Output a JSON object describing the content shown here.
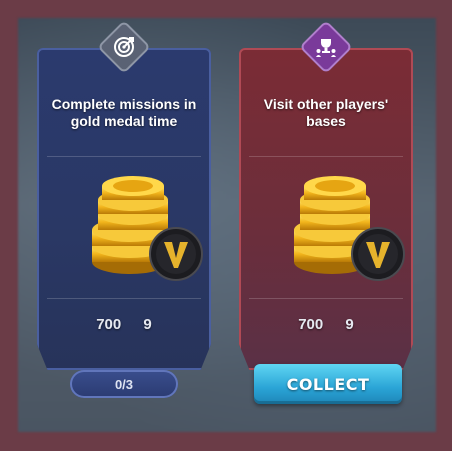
{
  "cards": [
    {
      "title": "Complete missions in gold medal time",
      "icon": "target-icon",
      "rewards": {
        "coins": "700",
        "v_tokens": "9"
      },
      "progress": "0/3"
    },
    {
      "title": "Visit other players' bases",
      "icon": "trophy-icon",
      "rewards": {
        "coins": "700",
        "v_tokens": "9"
      },
      "action_label": "COLLECT"
    }
  ],
  "colors": {
    "card_blue": "#2b3a6e",
    "card_red": "#7b2c35",
    "collect_button": "#2aa4d6",
    "background": "#6b3c47"
  }
}
